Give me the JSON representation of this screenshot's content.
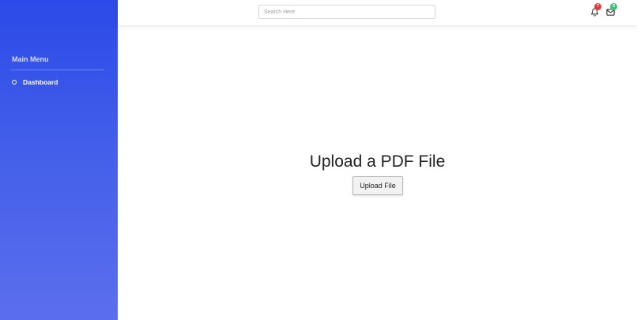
{
  "sidebar": {
    "menu_title": "Main Menu",
    "items": [
      {
        "label": "Dashboard",
        "icon": "circle-ring-icon"
      }
    ]
  },
  "topbar": {
    "search": {
      "placeholder": "Search Here",
      "value": ""
    },
    "notifications": {
      "icon": "bell-icon",
      "count": "7",
      "badge_color": "#e23b3b"
    },
    "messages": {
      "icon": "mail-icon",
      "count": "3",
      "badge_color": "#3bc178"
    }
  },
  "main": {
    "title": "Upload a PDF File",
    "upload_button_label": "Upload File"
  },
  "colors": {
    "sidebar_top": "#2b4ae8",
    "sidebar_bottom": "#5b6eed"
  }
}
